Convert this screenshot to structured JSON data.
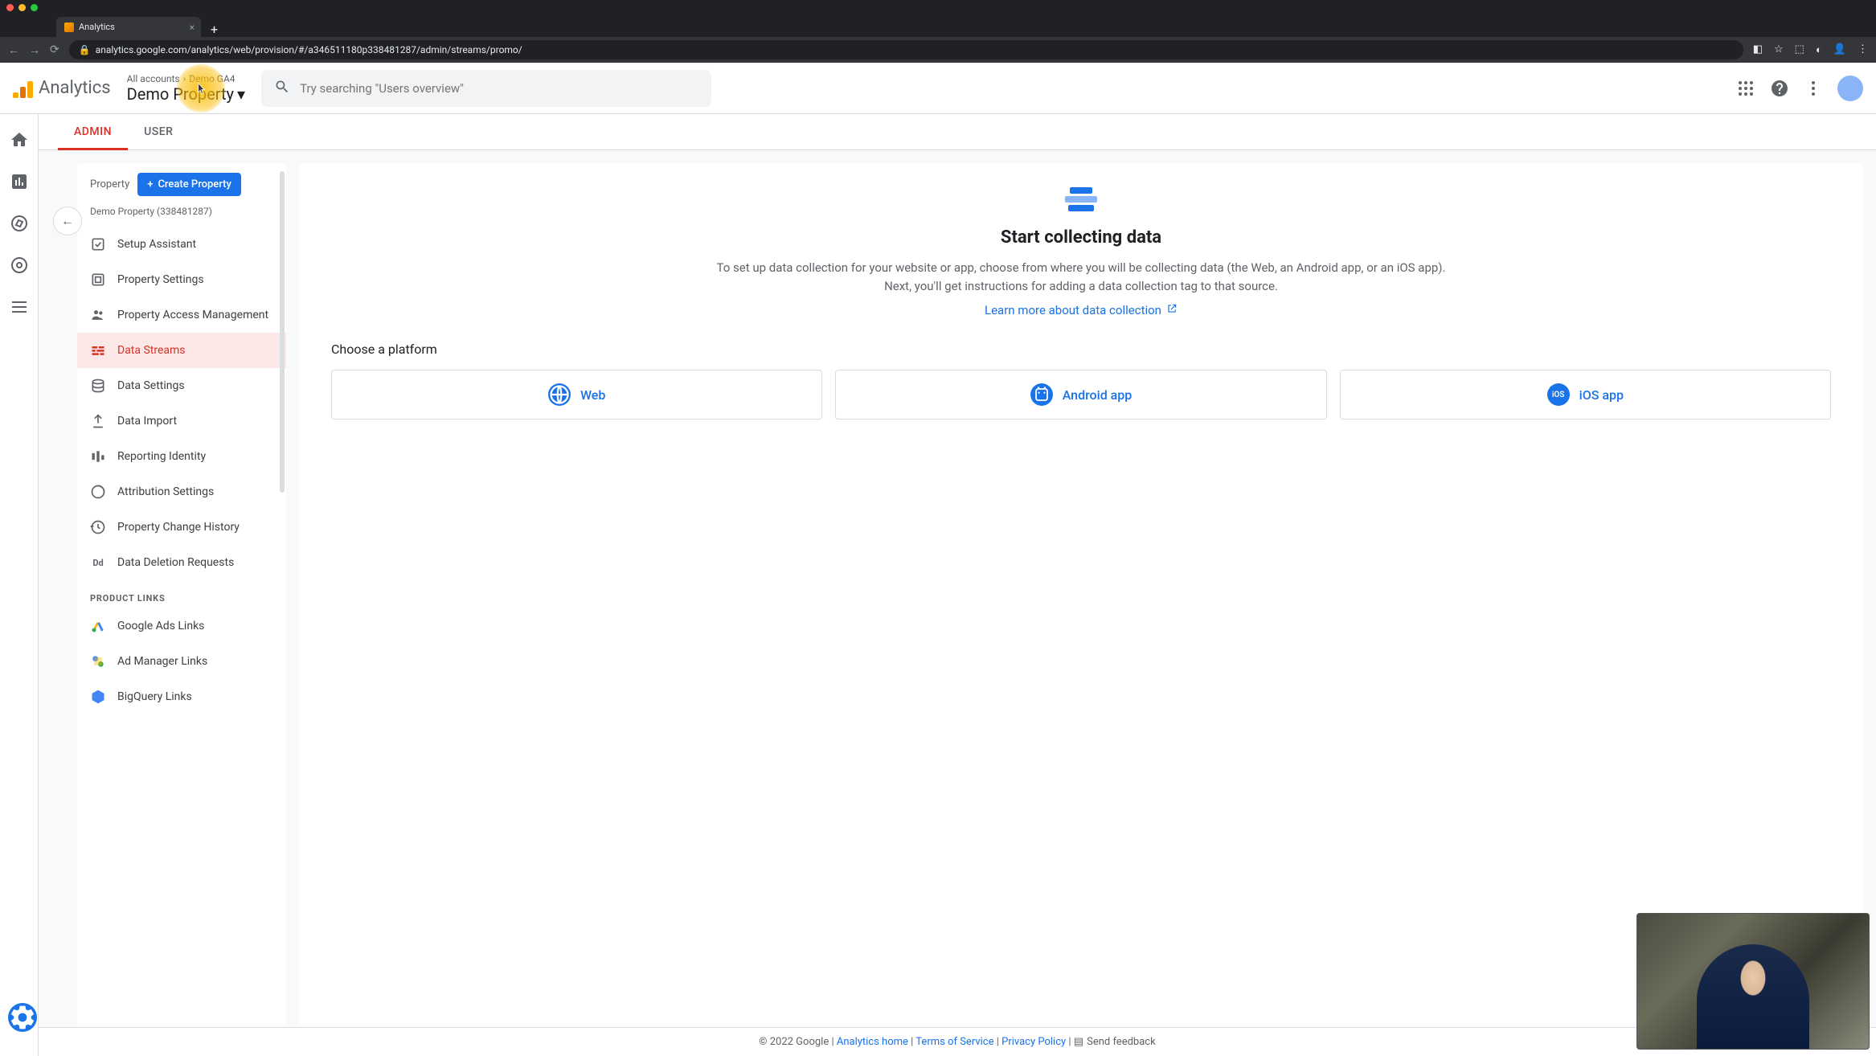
{
  "browser": {
    "tab_title": "Analytics",
    "url": "analytics.google.com/analytics/web/provision/#/a346511180p338481287/admin/streams/promo/"
  },
  "header": {
    "app_name": "Analytics",
    "breadcrumb_all": "All accounts",
    "breadcrumb_account": "Demo GA4",
    "property_name": "Demo Property",
    "search_placeholder": "Try searching \"Users overview\""
  },
  "tabs": {
    "admin": "ADMIN",
    "user": "USER"
  },
  "property_col": {
    "label": "Property",
    "create_btn": "Create Property",
    "subtitle": "Demo Property (338481287)",
    "items": [
      {
        "label": "Setup Assistant"
      },
      {
        "label": "Property Settings"
      },
      {
        "label": "Property Access Management"
      },
      {
        "label": "Data Streams"
      },
      {
        "label": "Data Settings"
      },
      {
        "label": "Data Import"
      },
      {
        "label": "Reporting Identity"
      },
      {
        "label": "Attribution Settings"
      },
      {
        "label": "Property Change History"
      },
      {
        "label": "Data Deletion Requests"
      }
    ],
    "section_label": "PRODUCT LINKS",
    "links": [
      {
        "label": "Google Ads Links"
      },
      {
        "label": "Ad Manager Links"
      },
      {
        "label": "BigQuery Links"
      }
    ]
  },
  "main": {
    "title": "Start collecting data",
    "desc": "To set up data collection for your website or app, choose from where you will be collecting data (the Web, an Android app, or an iOS app). Next, you'll get instructions for adding a data collection tag to that source.",
    "learn_link": "Learn more about data collection",
    "choose_label": "Choose a platform",
    "platforms": {
      "web": "Web",
      "android": "Android app",
      "ios": "iOS app"
    }
  },
  "footer": {
    "copyright": "© 2022 Google",
    "home": "Analytics home",
    "terms": "Terms of Service",
    "privacy": "Privacy Policy",
    "feedback": "Send feedback"
  }
}
